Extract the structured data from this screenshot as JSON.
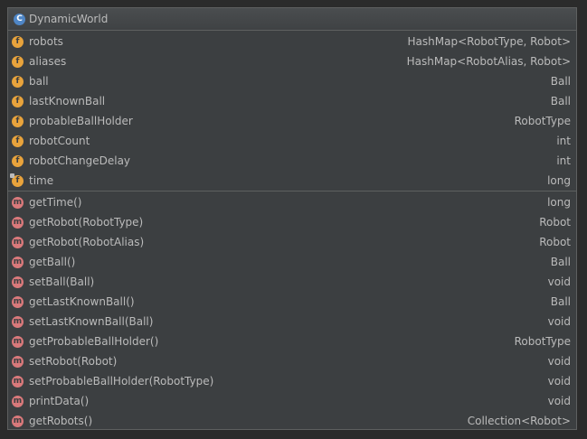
{
  "header": {
    "class_name": "DynamicWorld",
    "icon": "class-icon"
  },
  "fields": [
    {
      "name": "robots",
      "type": "HashMap<RobotType, Robot>",
      "icon": "field-icon"
    },
    {
      "name": "aliases",
      "type": "HashMap<RobotAlias, Robot>",
      "icon": "field-icon"
    },
    {
      "name": "ball",
      "type": "Ball",
      "icon": "field-icon"
    },
    {
      "name": "lastKnownBall",
      "type": "Ball",
      "icon": "field-icon"
    },
    {
      "name": "probableBallHolder",
      "type": "RobotType",
      "icon": "field-icon"
    },
    {
      "name": "robotCount",
      "type": "int",
      "icon": "field-icon"
    },
    {
      "name": "robotChangeDelay",
      "type": "int",
      "icon": "field-icon"
    },
    {
      "name": "time",
      "type": "long",
      "icon": "field-icon-locked"
    }
  ],
  "methods": [
    {
      "name": "getTime()",
      "type": "long",
      "icon": "method-icon"
    },
    {
      "name": "getRobot(RobotType)",
      "type": "Robot",
      "icon": "method-icon"
    },
    {
      "name": "getRobot(RobotAlias)",
      "type": "Robot",
      "icon": "method-icon"
    },
    {
      "name": "getBall()",
      "type": "Ball",
      "icon": "method-icon"
    },
    {
      "name": "setBall(Ball)",
      "type": "void",
      "icon": "method-icon"
    },
    {
      "name": "getLastKnownBall()",
      "type": "Ball",
      "icon": "method-icon"
    },
    {
      "name": "setLastKnownBall(Ball)",
      "type": "void",
      "icon": "method-icon"
    },
    {
      "name": "getProbableBallHolder()",
      "type": "RobotType",
      "icon": "method-icon"
    },
    {
      "name": "setRobot(Robot)",
      "type": "void",
      "icon": "method-icon"
    },
    {
      "name": "setProbableBallHolder(RobotType)",
      "type": "void",
      "icon": "method-icon"
    },
    {
      "name": "printData()",
      "type": "void",
      "icon": "method-icon"
    },
    {
      "name": "getRobots()",
      "type": "Collection<Robot>",
      "icon": "method-icon"
    }
  ],
  "colors": {
    "background": "#2b2b2b",
    "panel": "#3c3f41",
    "border": "#5e6060",
    "text": "#bbbbbb",
    "class_icon": "#4f86c6",
    "field_icon": "#e8a33c",
    "method_icon": "#d9797b"
  }
}
